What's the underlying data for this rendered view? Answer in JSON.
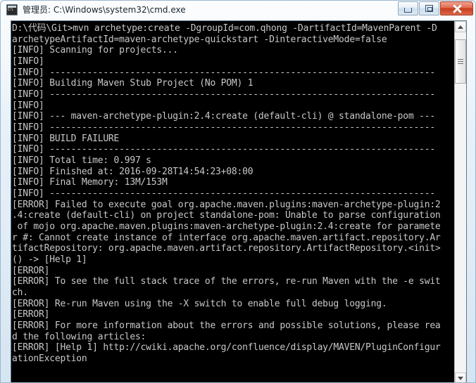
{
  "window": {
    "title": "管理员: C:\\Windows\\system32\\cmd.exe",
    "icon": "cmd-icon",
    "minimize_label": "最小化",
    "maximize_label": "最大化",
    "close_label": "关闭",
    "frame_color": "#d4e3f0",
    "close_color": "#c93b1c"
  },
  "console": {
    "background": "#000000",
    "foreground": "#c8c8c8",
    "columns": 80,
    "lines": [
      "D:\\代码\\Git>mvn archetype:create -DgroupId=com.qhong -DartifactId=MavenParent -D",
      "archetypeArtifactId=maven-archetype-quickstart -DinteractiveMode=false",
      "[INFO] Scanning for projects...",
      "[INFO]",
      "[INFO] ------------------------------------------------------------------------",
      "[INFO] Building Maven Stub Project (No POM) 1",
      "[INFO] ------------------------------------------------------------------------",
      "[INFO]",
      "[INFO] --- maven-archetype-plugin:2.4:create (default-cli) @ standalone-pom ---",
      "[INFO] ------------------------------------------------------------------------",
      "[INFO] BUILD FAILURE",
      "[INFO] ------------------------------------------------------------------------",
      "[INFO] Total time: 0.997 s",
      "[INFO] Finished at: 2016-09-28T14:54:23+08:00",
      "[INFO] Final Memory: 13M/153M",
      "[INFO] ------------------------------------------------------------------------",
      "[ERROR] Failed to execute goal org.apache.maven.plugins:maven-archetype-plugin:2",
      ".4:create (default-cli) on project standalone-pom: Unable to parse configuration",
      " of mojo org.apache.maven.plugins:maven-archetype-plugin:2.4:create for paramete",
      "r #: Cannot create instance of interface org.apache.maven.artifact.repository.Ar",
      "tifactRepository: org.apache.maven.artifact.repository.ArtifactRepository.<init>",
      "() -> [Help 1]",
      "[ERROR]",
      "[ERROR] To see the full stack trace of the errors, re-run Maven with the -e swit",
      "ch.",
      "[ERROR] Re-run Maven using the -X switch to enable full debug logging.",
      "[ERROR]",
      "[ERROR] For more information about the errors and possible solutions, please rea",
      "d the following articles:",
      "[ERROR] [Help 1] http://cwiki.apache.org/confluence/display/MAVEN/PluginConfigur",
      "ationException"
    ]
  },
  "scrollbar": {
    "orientation": "vertical",
    "up_arrow": "scroll-up-arrow",
    "down_arrow": "scroll-down-arrow",
    "thumb_position_percent": 2,
    "thumb_size_percent": 13
  }
}
